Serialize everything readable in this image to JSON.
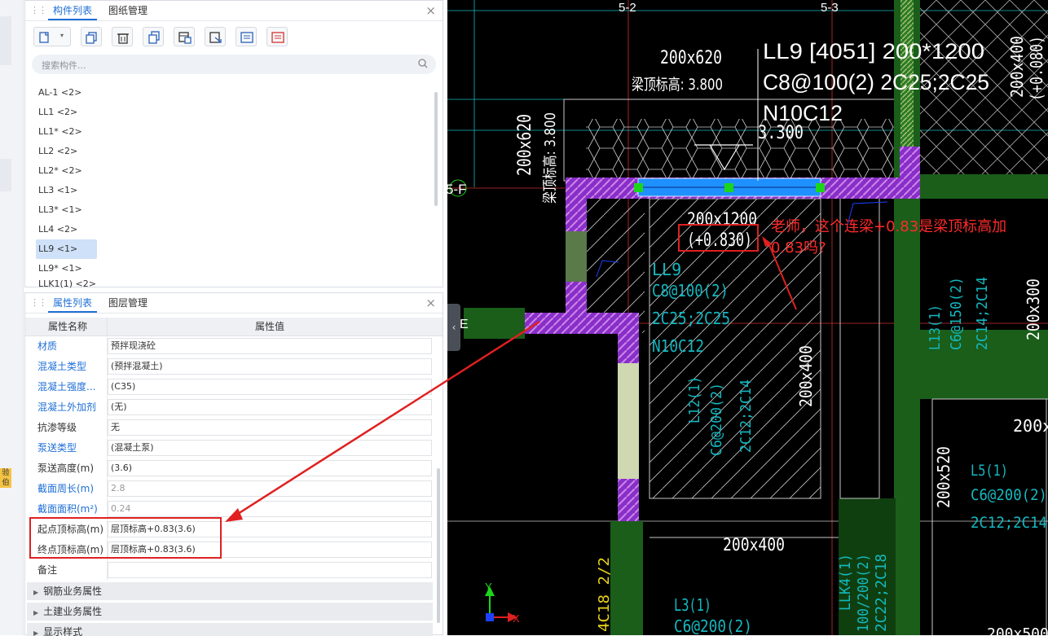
{
  "components_panel": {
    "tabs": [
      "构件列表",
      "图纸管理"
    ],
    "search_placeholder": "搜索构件...",
    "items": [
      "AL-1 <2>",
      "LL1 <2>",
      "LL1* <2>",
      "LL2 <2>",
      "LL2* <2>",
      "LL3 <1>",
      "LL3* <1>",
      "LL4 <2>",
      "LL9 <1>",
      "LL9* <1>",
      "LLK1(1) <2>"
    ],
    "selected": "LL9 <1>"
  },
  "properties_panel": {
    "tabs": [
      "属性列表",
      "图层管理"
    ],
    "col_name": "属性名称",
    "col_value": "属性值",
    "rows": [
      {
        "name": "材质",
        "value": "预拌现浇砼"
      },
      {
        "name": "混凝土类型",
        "value": "(预拌混凝土)"
      },
      {
        "name": "混凝土强度...",
        "value": "(C35)"
      },
      {
        "name": "混凝土外加剂",
        "value": "(无)"
      },
      {
        "name": "抗渗等级",
        "value": "无"
      },
      {
        "name": "泵送类型",
        "value": "(混凝土泵)"
      },
      {
        "name": "泵送高度(m)",
        "value": "(3.6)"
      },
      {
        "name": "截面周长(m)",
        "value": "2.8"
      },
      {
        "name": "截面面积(m²)",
        "value": "0.24"
      },
      {
        "name": "起点顶标高(m)",
        "value": "层顶标高+0.83(3.6)"
      },
      {
        "name": "终点顶标高(m)",
        "value": "层顶标高+0.83(3.6)"
      },
      {
        "name": "备注",
        "value": ""
      }
    ],
    "groups": [
      "钢筋业务属性",
      "土建业务属性",
      "显示样式"
    ]
  },
  "side_tag": "验伯",
  "cad": {
    "grid_labels": [
      "5-2",
      "5-3",
      "5-F",
      "E"
    ],
    "beam_top_label": "200x620",
    "beam_top_elev": "梁顶标高: 3.800",
    "ll9_line1": "LL9 [4051] 200*1200",
    "ll9_line2": "C8@100(2) 2C25;2C25",
    "ll9_line3": "N10C12",
    "elev_330": "3.300",
    "vert_200x620": "200x620",
    "vert_elev": "梁顶标高: 3.800",
    "beam_size": "200x1200",
    "beam_offset": "(+0.830)",
    "ll9_cyan": [
      "LL9",
      "C8@100(2)",
      "2C25;2C25",
      "N10C12"
    ],
    "l12": [
      "L12(1)",
      "C6@200(2)",
      "2C12;2C14"
    ],
    "v200x400": "200x400",
    "l13": [
      "L13(1)",
      "C6@150(2)",
      "2C14;2C14"
    ],
    "v200x300": "200x300",
    "v200x400_top": "200x400",
    "v0080": "(+0.080)",
    "h200x400_bottom": "200x400",
    "v200x520": "200x520",
    "l5": [
      "L5(1)",
      "C6@200(2)",
      "2C12;2C14"
    ],
    "h200x_right": "200x",
    "l3": [
      "L3(1)",
      "C6@200(2)"
    ],
    "llk4": [
      "LLK4(1)",
      "100/200(2)",
      "2C22;2C18"
    ],
    "vert_4c18": "4C18 2/2",
    "bottom_right": "200x500",
    "axis_y": "Y",
    "axis_x": "X"
  },
  "annotation": {
    "line1": "老师，这个连梁+0.83是梁顶标高加",
    "line2": "0.83吗?"
  },
  "colors": {
    "accent": "#1f6fd6",
    "red": "#e02020",
    "cad_bg": "#000000",
    "cyan": "#14b8c0"
  }
}
